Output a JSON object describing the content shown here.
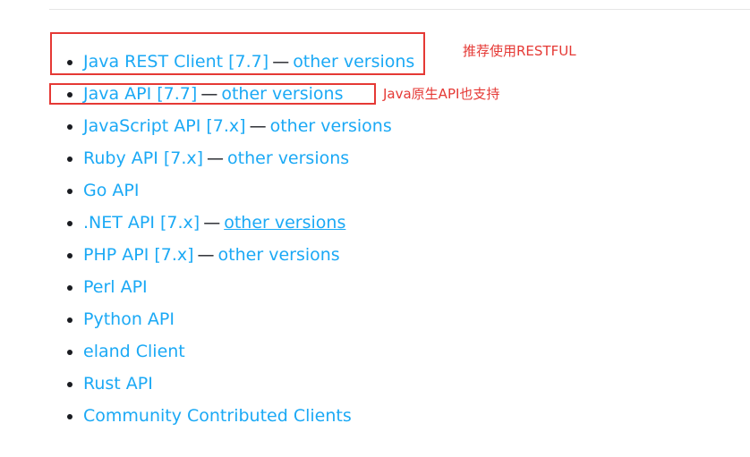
{
  "clients": [
    {
      "name": "Java REST Client [7.7]",
      "versions_link": "other versions",
      "underlined": false
    },
    {
      "name": "Java API [7.7]",
      "versions_link": "other versions",
      "underlined": false
    },
    {
      "name": "JavaScript API [7.x]",
      "versions_link": "other versions",
      "underlined": false
    },
    {
      "name": "Ruby API [7.x]",
      "versions_link": "other versions",
      "underlined": false
    },
    {
      "name": "Go API",
      "versions_link": null,
      "underlined": false
    },
    {
      "name": ".NET API [7.x]",
      "versions_link": "other versions",
      "underlined": true
    },
    {
      "name": "PHP API [7.x]",
      "versions_link": "other versions",
      "underlined": false
    },
    {
      "name": "Perl API",
      "versions_link": null,
      "underlined": false
    },
    {
      "name": "Python API",
      "versions_link": null,
      "underlined": false
    },
    {
      "name": "eland Client",
      "versions_link": null,
      "underlined": false
    },
    {
      "name": "Rust API",
      "versions_link": null,
      "underlined": false
    },
    {
      "name": "Community Contributed Clients",
      "versions_link": null,
      "underlined": false
    }
  ],
  "separator": "—",
  "annotations": {
    "rest_recommendation": "推荐使用RESTFUL",
    "java_api_note": "Java原生API也支持"
  },
  "colors": {
    "link": "#1ba9f5",
    "annotation": "#e53935",
    "bullet": "#1a1c21"
  }
}
